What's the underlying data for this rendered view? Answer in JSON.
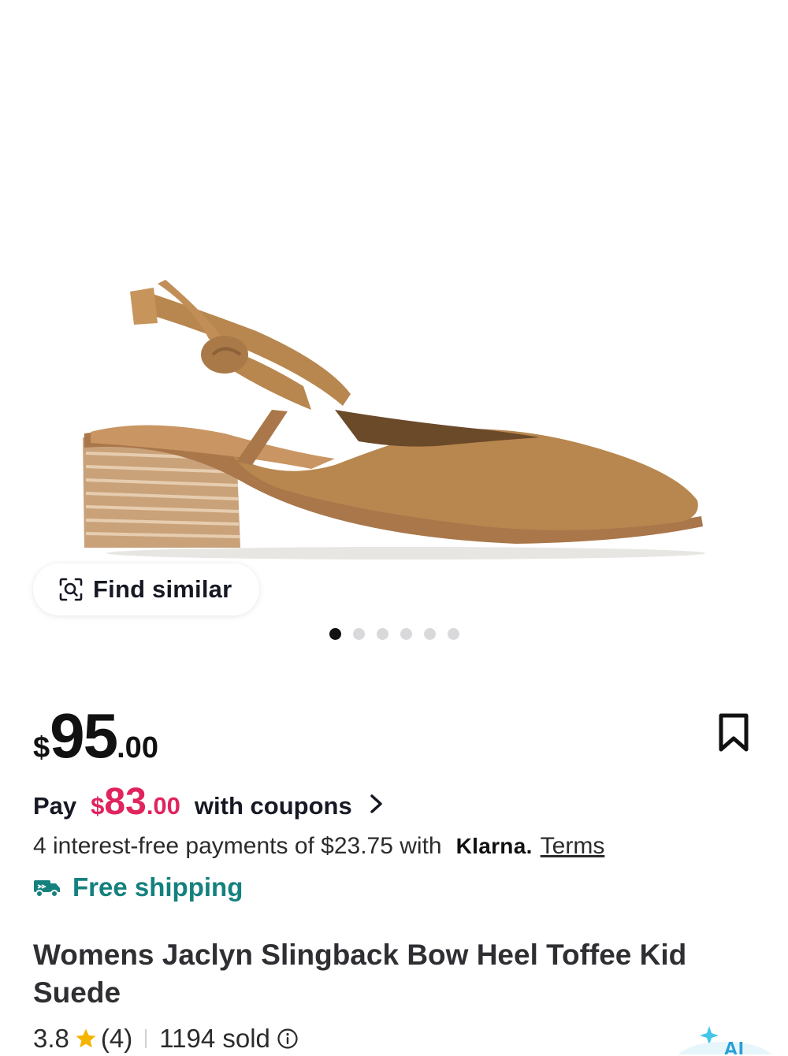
{
  "gallery": {
    "find_similar_label": "Find similar",
    "dots_total": 6,
    "active_dot": 1
  },
  "price": {
    "currency": "$",
    "whole": "95",
    "cents": ".00"
  },
  "coupon": {
    "pay_label": "Pay",
    "currency": "$",
    "whole": "83",
    "cents": ".00",
    "suffix": "with coupons"
  },
  "klarna": {
    "text": "4 interest-free payments of $23.75 with",
    "brand": "Klarna.",
    "terms": "Terms"
  },
  "shipping": {
    "label": "Free shipping"
  },
  "product": {
    "title": "Womens Jaclyn Slingback Bow Heel Toffee Kid Suede",
    "rating": "3.8",
    "reviews": "(4)",
    "sold": "1194 sold"
  },
  "icons": {
    "find_similar": "image-search-icon",
    "bookmark": "bookmark-icon",
    "chevron": "chevron-right-icon",
    "truck": "truck-icon",
    "star": "star-icon",
    "info": "info-icon",
    "ai": "ai-sparkle-icon"
  },
  "colors": {
    "coupon_price": "#e0245e",
    "shipping": "#14817e",
    "star": "#f5b400",
    "suede": "#b8874f"
  }
}
